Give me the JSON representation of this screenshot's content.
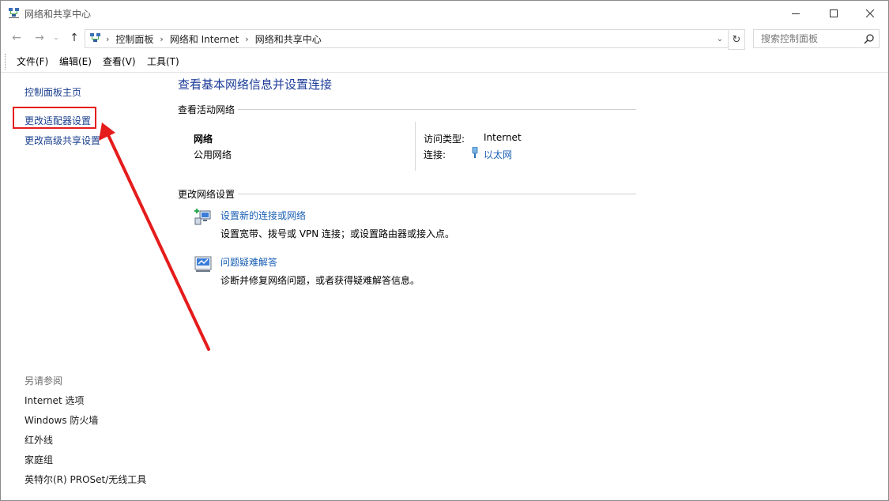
{
  "window": {
    "title": "网络和共享中心"
  },
  "address": {
    "crumbs": [
      "控制面板",
      "网络和 Internet",
      "网络和共享中心"
    ],
    "search_placeholder": "搜索控制面板"
  },
  "menu": [
    "文件(F)",
    "编辑(E)",
    "查看(V)",
    "工具(T)"
  ],
  "left_pane": {
    "home": "控制面板主页",
    "change_adapter": "更改适配器设置",
    "advanced_sharing": "更改高级共享设置",
    "see_also_heading": "另请参阅",
    "see_also": [
      "Internet 选项",
      "Windows 防火墙",
      "红外线",
      "家庭组",
      "英特尔(R) PROSet/无线工具"
    ]
  },
  "main": {
    "title": "查看基本网络信息并设置连接",
    "active_heading": "查看活动网络",
    "network_name": "网络",
    "network_type": "公用网络",
    "access_type_label": "访问类型:",
    "access_type_value": "Internet",
    "connection_label": "连接:",
    "connection_value": "以太网",
    "change_heading": "更改网络设置",
    "tasks": [
      {
        "link": "设置新的连接或网络",
        "desc": "设置宽带、拨号或 VPN 连接；或设置路由器或接入点。",
        "icon": "new-connection-icon"
      },
      {
        "link": "问题疑难解答",
        "desc": "诊断并修复网络问题，或者获得疑难解答信息。",
        "icon": "troubleshoot-icon"
      }
    ]
  },
  "colors": {
    "link": "#1a3f8c",
    "title": "#1e3d9a",
    "annotation": "#e51c1c"
  }
}
